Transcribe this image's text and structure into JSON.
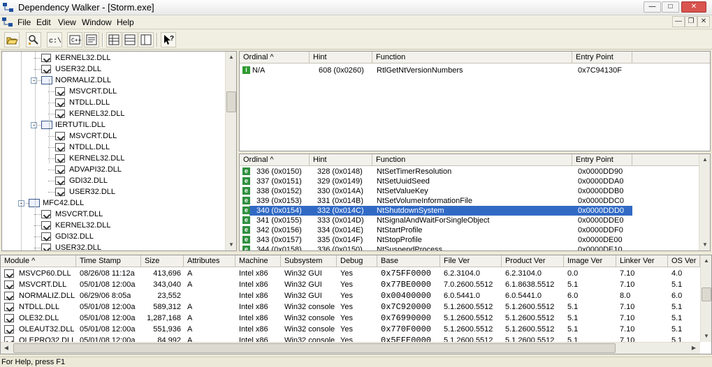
{
  "window": {
    "title": "Dependency Walker - [Storm.exe]"
  },
  "menu": [
    "File",
    "Edit",
    "View",
    "Window",
    "Help"
  ],
  "toolbar": [
    "open-icon",
    "find-icon",
    "full-paths-icon",
    "undecorate-icon",
    "properties-icon",
    "expand-icon",
    "collapse-icon",
    "sys-info-icon",
    "help-icon"
  ],
  "tree": [
    {
      "label": "KERNEL32.DLL",
      "level": 2
    },
    {
      "label": "USER32.DLL",
      "level": 2
    },
    {
      "label": "NORMALIZ.DLL",
      "level": 2,
      "expander": "-"
    },
    {
      "label": "MSVCRT.DLL",
      "level": 3
    },
    {
      "label": "NTDLL.DLL",
      "level": 3
    },
    {
      "label": "KERNEL32.DLL",
      "level": 3
    },
    {
      "label": "IERTUTIL.DLL",
      "level": 2,
      "expander": "-"
    },
    {
      "label": "MSVCRT.DLL",
      "level": 3
    },
    {
      "label": "NTDLL.DLL",
      "level": 3
    },
    {
      "label": "KERNEL32.DLL",
      "level": 3
    },
    {
      "label": "ADVAPI32.DLL",
      "level": 3
    },
    {
      "label": "GDI32.DLL",
      "level": 3
    },
    {
      "label": "USER32.DLL",
      "level": 3
    },
    {
      "label": "MFC42.DLL",
      "level": 1,
      "expander": "-"
    },
    {
      "label": "MSVCRT.DLL",
      "level": 2
    },
    {
      "label": "KERNEL32.DLL",
      "level": 2
    },
    {
      "label": "GDI32.DLL",
      "level": 2
    },
    {
      "label": "USER32.DLL",
      "level": 2
    }
  ],
  "imports": {
    "headers": [
      "Ordinal ^",
      "Hint",
      "Function",
      "Entry Point"
    ],
    "rows": [
      {
        "icon": "i",
        "ordinal": "N/A",
        "hint": "608  (0x0260)",
        "function": "RtlGetNtVersionNumbers",
        "entry": "0x7C94130F"
      }
    ]
  },
  "exports": {
    "headers": [
      "Ordinal ^",
      "Hint",
      "Function",
      "Entry Point"
    ],
    "rows": [
      {
        "ordinal": "336  (0x0150)",
        "hint": "328  (0x0148)",
        "function": "NtSetTimerResolution",
        "entry": "0x0000DD90"
      },
      {
        "ordinal": "337  (0x0151)",
        "hint": "329  (0x0149)",
        "function": "NtSetUuidSeed",
        "entry": "0x0000DDA0"
      },
      {
        "ordinal": "338  (0x0152)",
        "hint": "330  (0x014A)",
        "function": "NtSetValueKey",
        "entry": "0x0000DDB0"
      },
      {
        "ordinal": "339  (0x0153)",
        "hint": "331  (0x014B)",
        "function": "NtSetVolumeInformationFile",
        "entry": "0x0000DDC0"
      },
      {
        "ordinal": "340  (0x0154)",
        "hint": "332  (0x014C)",
        "function": "NtShutdownSystem",
        "entry": "0x0000DDD0",
        "selected": true
      },
      {
        "ordinal": "341  (0x0155)",
        "hint": "333  (0x014D)",
        "function": "NtSignalAndWaitForSingleObject",
        "entry": "0x0000DDE0"
      },
      {
        "ordinal": "342  (0x0156)",
        "hint": "334  (0x014E)",
        "function": "NtStartProfile",
        "entry": "0x0000DDF0"
      },
      {
        "ordinal": "343  (0x0157)",
        "hint": "335  (0x014F)",
        "function": "NtStopProfile",
        "entry": "0x0000DE00"
      },
      {
        "ordinal": "344  (0x0158)",
        "hint": "336  (0x0150)",
        "function": "NtSuspendProcess",
        "entry": "0x0000DE10"
      }
    ]
  },
  "modules": {
    "headers": [
      "Module ^",
      "Time Stamp",
      "Size",
      "Attributes",
      "Machine",
      "Subsystem",
      "Debug",
      "Base",
      "File Ver",
      "Product Ver",
      "Image Ver",
      "Linker Ver",
      "OS Ver"
    ],
    "rows": [
      [
        "MSVCP60.DLL",
        "08/26/08  11:12a",
        "413,696",
        "A",
        "Intel x86",
        "Win32 GUI",
        "Yes",
        "0x75FF0000",
        "6.2.3104.0",
        "6.2.3104.0",
        "0.0",
        "7.10",
        "4.0"
      ],
      [
        "MSVCRT.DLL",
        "05/01/08  12:00a",
        "343,040",
        "A",
        "Intel x86",
        "Win32 GUI",
        "Yes",
        "0x77BE0000",
        "7.0.2600.5512",
        "6.1.8638.5512",
        "5.1",
        "7.10",
        "5.1"
      ],
      [
        "NORMALIZ.DLL",
        "06/29/06   8:05a",
        "23,552",
        "",
        "Intel x86",
        "Win32 GUI",
        "Yes",
        "0x00400000",
        "6.0.5441.0",
        "6.0.5441.0",
        "6.0",
        "8.0",
        "6.0"
      ],
      [
        "NTDLL.DLL",
        "05/01/08  12:00a",
        "589,312",
        "A",
        "Intel x86",
        "Win32 console",
        "Yes",
        "0x7C920000",
        "5.1.2600.5512",
        "5.1.2600.5512",
        "5.1",
        "7.10",
        "5.1"
      ],
      [
        "OLE32.DLL",
        "05/01/08  12:00a",
        "1,287,168",
        "A",
        "Intel x86",
        "Win32 console",
        "Yes",
        "0x76990000",
        "5.1.2600.5512",
        "5.1.2600.5512",
        "5.1",
        "7.10",
        "5.1"
      ],
      [
        "OLEAUT32.DLL",
        "05/01/08  12:00a",
        "551,936",
        "A",
        "Intel x86",
        "Win32 console",
        "Yes",
        "0x770F0000",
        "5.1.2600.5512",
        "5.1.2600.5512",
        "5.1",
        "7.10",
        "5.1"
      ],
      [
        "OLEPRO32.DLL",
        "05/01/08  12:00a",
        "84,992",
        "A",
        "Intel x86",
        "Win32 console",
        "Yes",
        "0x5EFE0000",
        "5.1.2600.5512",
        "5.1.2600.5512",
        "5.1",
        "7.10",
        "5.1"
      ]
    ]
  },
  "status": "For Help, press F1"
}
